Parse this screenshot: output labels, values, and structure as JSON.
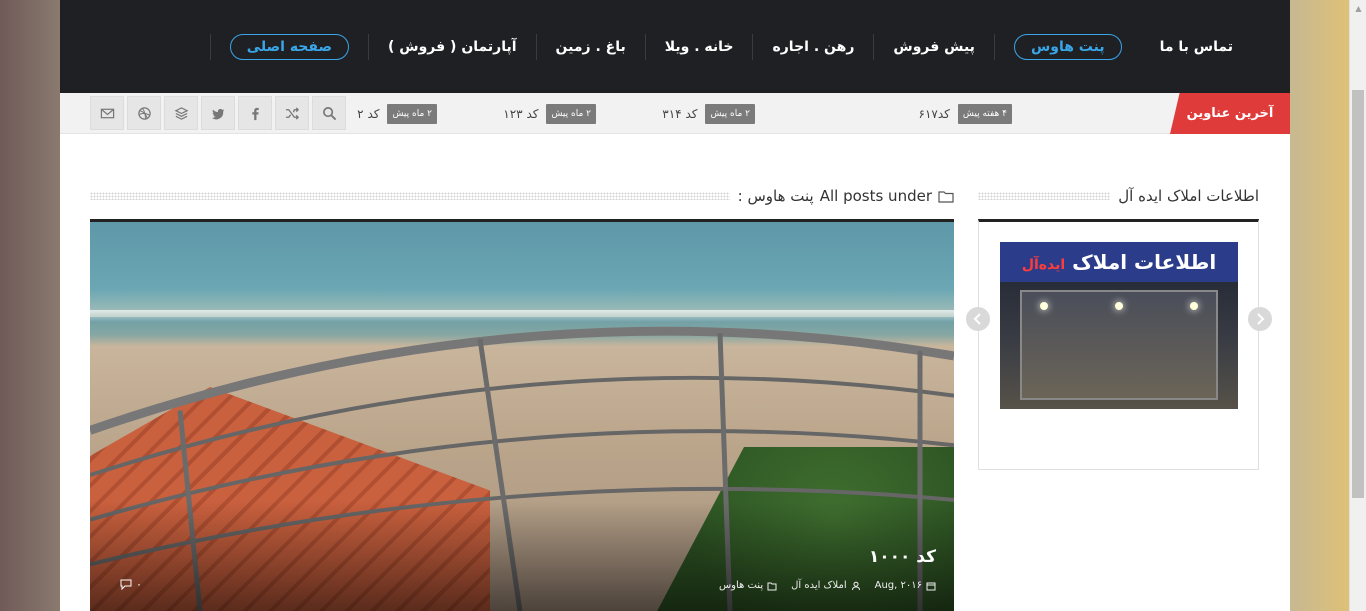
{
  "nav": {
    "items": [
      {
        "label": "صفحه اصلی",
        "active": true
      },
      {
        "label": "آپارتمان ( فروش )"
      },
      {
        "label": "باغ . زمین"
      },
      {
        "label": "خانه . ویلا"
      },
      {
        "label": "رهن . اجاره"
      },
      {
        "label": "پیش فروش"
      },
      {
        "label": "پنت هاوس",
        "highlight": true
      },
      {
        "label": "تماس با ما"
      }
    ]
  },
  "ticker": {
    "label": "آخرین عناوین",
    "items": [
      {
        "badge": "۴ هفته پیش",
        "text": "کد۶۱۷"
      },
      {
        "badge": "۲ ماه پیش",
        "text": "کد ۳۱۴"
      },
      {
        "badge": "۲ ماه پیش",
        "text": "کد ۱۲۳"
      },
      {
        "badge": "۲ ماه پیش",
        "text": "کد ۲"
      }
    ]
  },
  "social": [
    "search-icon",
    "shuffle-icon",
    "facebook-icon",
    "twitter-icon",
    "layers-icon",
    "dribbble-icon",
    "mail-icon"
  ],
  "main": {
    "heading_prefix": "All posts under",
    "heading_category": "پنت هاوس :",
    "post": {
      "title": "کد ۱۰۰۰",
      "date": "Aug, ۲۰۱۶",
      "author": "املاک ایده آل",
      "category": "پنت هاوس",
      "comments": "۰"
    }
  },
  "sidebar": {
    "title": "اطلاعات املاک ایده آل",
    "sign_main": "اطلاعات املاک",
    "sign_sub": "ایده‌آل"
  },
  "colors": {
    "nav_bg": "#1f2024",
    "accent": "#3aa6e8",
    "ticker_red": "#e03b3b"
  }
}
